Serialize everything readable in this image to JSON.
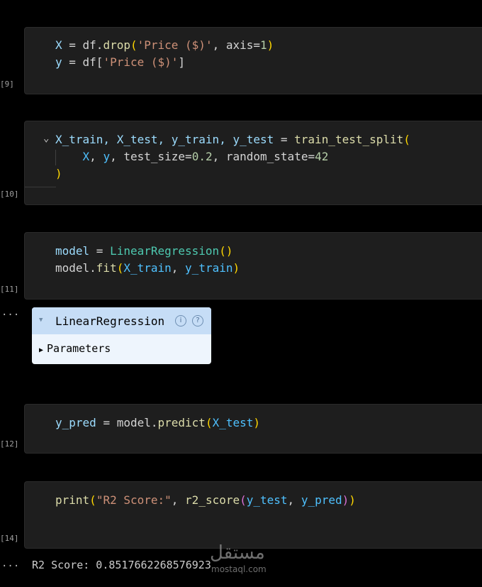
{
  "cells": [
    {
      "exec": "[9]"
    },
    {
      "exec": "[10]"
    },
    {
      "exec": "[11]"
    },
    {
      "exec": "[12]"
    },
    {
      "exec": "[14]"
    }
  ],
  "code": {
    "c9_l1_a": "X ",
    "c9_l1_b": "= ",
    "c9_l1_c": "df.",
    "c9_l1_d": "drop",
    "c9_l1_e": "(",
    "c9_l1_f": "'Price ($)'",
    "c9_l1_g": ", axis",
    "c9_l1_h": "=",
    "c9_l1_i": "1",
    "c9_l1_j": ")",
    "c9_l2_a": "y ",
    "c9_l2_b": "= ",
    "c9_l2_c": "df[",
    "c9_l2_d": "'Price ($)'",
    "c9_l2_e": "]",
    "c10_l1_a": "X_train, X_test, y_train, y_test ",
    "c10_l1_b": "= ",
    "c10_l1_c": "train_test_split",
    "c10_l1_d": "(",
    "c10_l2_a": "X",
    "c10_l2_b": ", ",
    "c10_l2_c": "y",
    "c10_l2_d": ", test_size",
    "c10_l2_e": "=",
    "c10_l2_f": "0.2",
    "c10_l2_g": ", random_state",
    "c10_l2_h": "=",
    "c10_l2_i": "42",
    "c10_l3_a": ")",
    "c11_l1_a": "model ",
    "c11_l1_b": "= ",
    "c11_l1_c": "LinearRegression",
    "c11_l1_d": "()",
    "c11_l2_a": "model.",
    "c11_l2_b": "fit",
    "c11_l2_c": "(",
    "c11_l2_d": "X_train",
    "c11_l2_e": ", ",
    "c11_l2_f": "y_train",
    "c11_l2_g": ")",
    "c12_l1_a": "y_pred ",
    "c12_l1_b": "= ",
    "c12_l1_c": "model.",
    "c12_l1_d": "predict",
    "c12_l1_e": "(",
    "c12_l1_f": "X_test",
    "c12_l1_g": ")",
    "c14_l1_a": "print",
    "c14_l1_b": "(",
    "c14_l1_c": "\"R2 Score:\"",
    "c14_l1_d": ", ",
    "c14_l1_e": "r2_score",
    "c14_l1_f": "(",
    "c14_l1_g": "y_test",
    "c14_l1_h": ", ",
    "c14_l1_i": "y_pred",
    "c14_l1_j": ")",
    "c14_l1_k": ")"
  },
  "output_ellipsis": "...",
  "widget": {
    "title": "LinearRegression",
    "info_icon": "i",
    "help_icon": "?",
    "params_label": "Parameters"
  },
  "output_text": "R2 Score: 0.8517662268576923",
  "watermark": {
    "arabic": "مستقل",
    "latin": "mostaql.com"
  },
  "colors": {
    "background": "#000000",
    "cell": "#1e1e1e",
    "widget_header": "#c6ddf6",
    "widget_body": "#eef5fd"
  }
}
